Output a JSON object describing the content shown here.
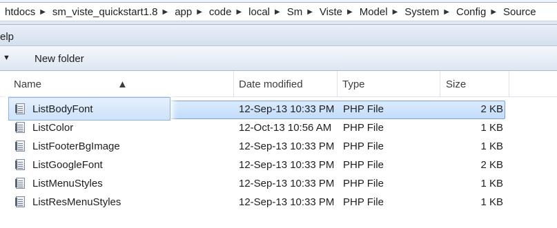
{
  "address_bar": {
    "crumbs": [
      "htdocs",
      "sm_viste_quickstart1.8",
      "app",
      "code",
      "local",
      "Sm",
      "Viste",
      "Model",
      "System",
      "Config",
      "Source"
    ]
  },
  "menu": {
    "help_label": "elp"
  },
  "toolbar": {
    "new_folder_label": "New folder"
  },
  "columns": {
    "name": "Name",
    "date_modified": "Date modified",
    "type": "Type",
    "size": "Size"
  },
  "files": [
    {
      "name": "ListBodyFont",
      "date": "12-Sep-13 10:33 PM",
      "type": "PHP File",
      "size": "2 KB",
      "selected": true
    },
    {
      "name": "ListColor",
      "date": "12-Oct-13 10:56 AM",
      "type": "PHP File",
      "size": "1 KB"
    },
    {
      "name": "ListFooterBgImage",
      "date": "12-Sep-13 10:33 PM",
      "type": "PHP File",
      "size": "1 KB"
    },
    {
      "name": "ListGoogleFont",
      "date": "12-Sep-13 10:33 PM",
      "type": "PHP File",
      "size": "2 KB"
    },
    {
      "name": "ListMenuStyles",
      "date": "12-Sep-13 10:33 PM",
      "type": "PHP File",
      "size": "1 KB"
    },
    {
      "name": "ListResMenuStyles",
      "date": "12-Sep-13 10:33 PM",
      "type": "PHP File",
      "size": "1 KB"
    }
  ],
  "icons": {
    "separator": "chevron-right-icon",
    "toolbar_dropdown": "triangle-down-icon",
    "sort": "sort-ascending-icon",
    "file": "php-file-icon"
  },
  "colors": {
    "selection": "#c9e0fb",
    "selection_border": "#7da2ce",
    "chrome": "#dde6f1"
  }
}
